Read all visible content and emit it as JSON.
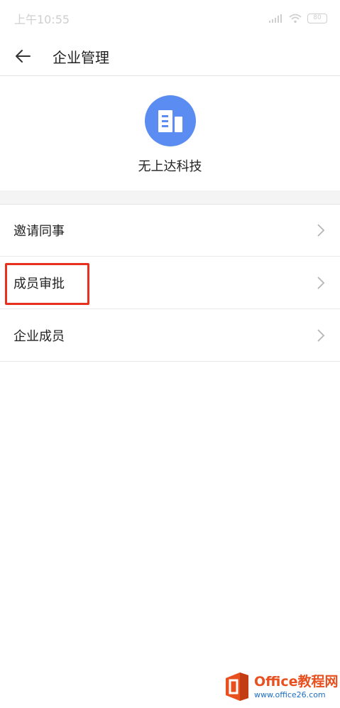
{
  "status_bar": {
    "time": "上午10:55",
    "battery": "80",
    "icons": [
      "signal-icon",
      "wifi-icon",
      "battery-icon"
    ]
  },
  "header": {
    "title": "企业管理",
    "back_icon": "back-arrow-icon"
  },
  "company": {
    "name": "无上达科技",
    "logo_icon": "building-icon",
    "logo_color": "#5b8cf2"
  },
  "menu": {
    "items": [
      {
        "label": "邀请同事",
        "icon": "chevron-right-icon"
      },
      {
        "label": "成员审批",
        "icon": "chevron-right-icon",
        "highlighted": true
      },
      {
        "label": "企业成员",
        "icon": "chevron-right-icon"
      }
    ]
  },
  "annotation": {
    "color": "#e8301f",
    "target": "成员审批"
  },
  "watermark": {
    "brand": "Office教程网",
    "url": "www.office26.com"
  }
}
